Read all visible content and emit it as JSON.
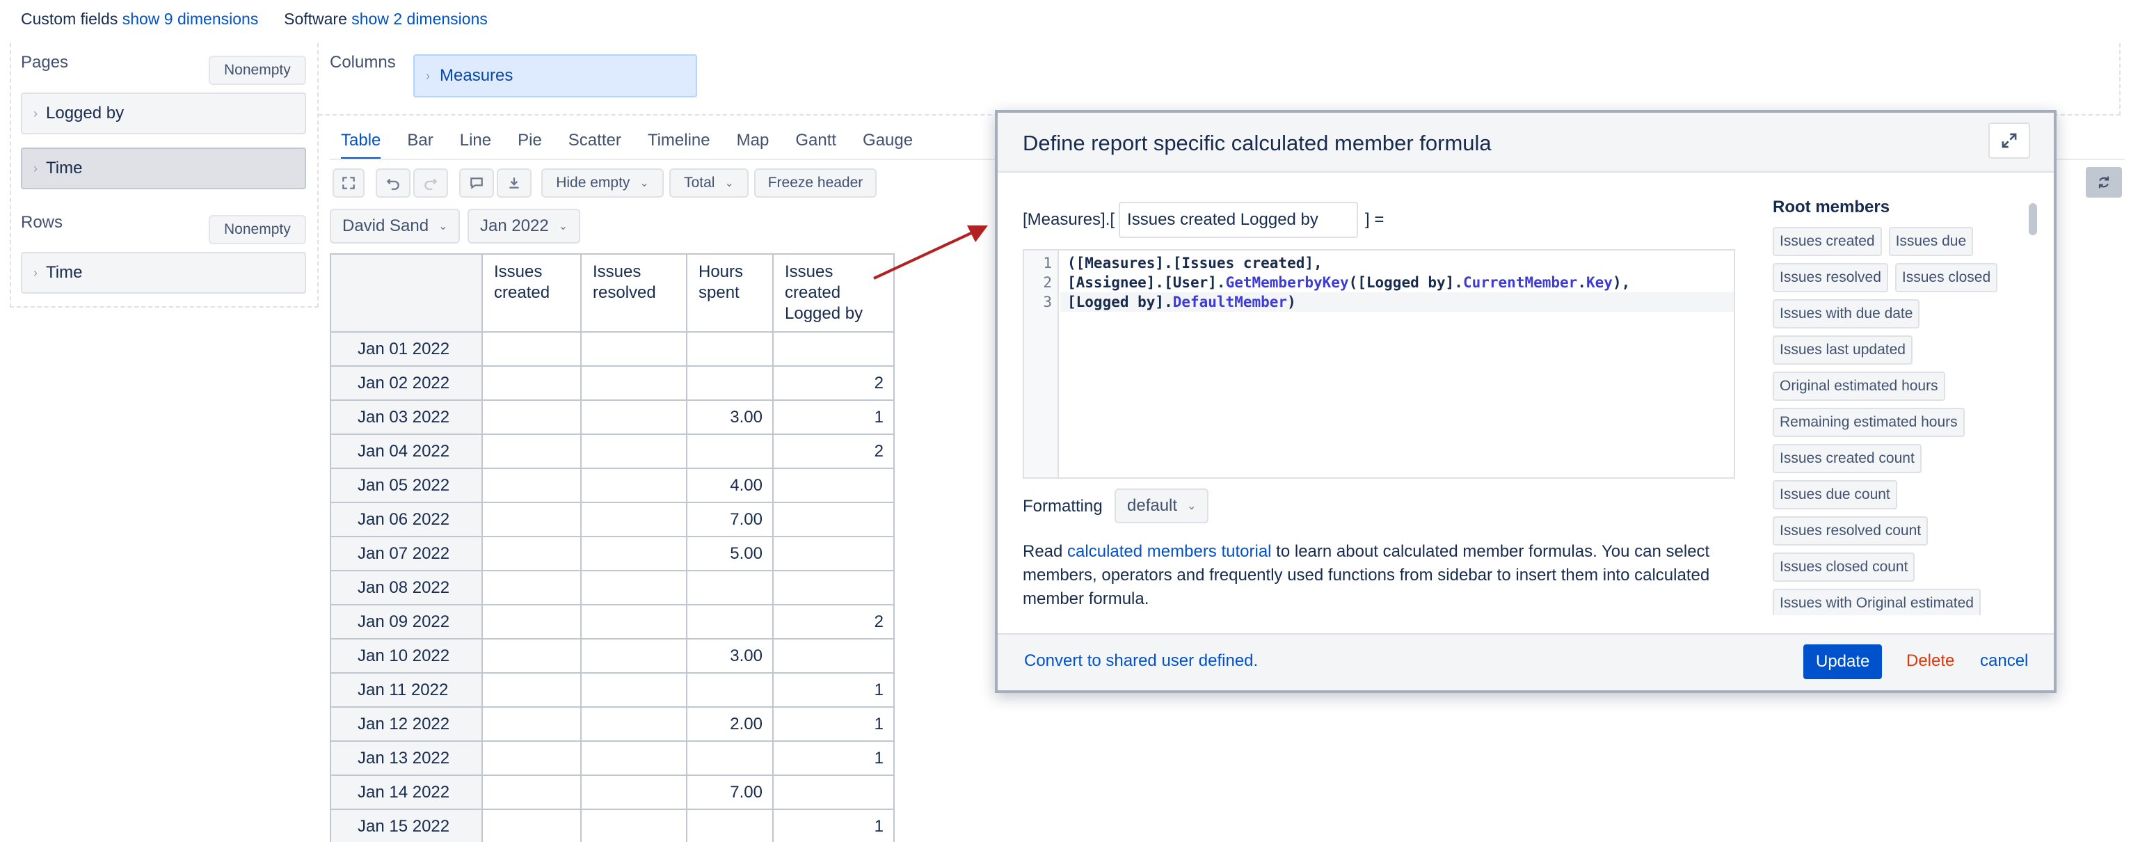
{
  "top_dims": {
    "custom_fields_label": "Custom fields",
    "custom_fields_link": "show 9 dimensions",
    "software_label": "Software",
    "software_link": "show 2 dimensions"
  },
  "pages": {
    "title": "Pages",
    "nonempty": "Nonempty",
    "items": [
      "Logged by",
      "Time"
    ]
  },
  "rows": {
    "title": "Rows",
    "nonempty": "Nonempty",
    "items": [
      "Time"
    ]
  },
  "columns": {
    "title": "Columns",
    "item": "Measures"
  },
  "chart_tabs": [
    "Table",
    "Bar",
    "Line",
    "Pie",
    "Scatter",
    "Timeline",
    "Map",
    "Gantt",
    "Gauge"
  ],
  "toolbar": {
    "hide_empty": "Hide empty",
    "total": "Total",
    "freeze_header": "Freeze header"
  },
  "filters": {
    "user": "David Sand",
    "period": "Jan 2022"
  },
  "table": {
    "headers": [
      [
        "Issues",
        "created"
      ],
      [
        "Issues",
        "resolved"
      ],
      [
        "Hours",
        "spent"
      ],
      [
        "Issues",
        "created",
        "Logged by"
      ]
    ],
    "rows": [
      {
        "label": "Jan 01 2022",
        "cells": [
          "",
          "",
          "",
          ""
        ]
      },
      {
        "label": "Jan 02 2022",
        "cells": [
          "",
          "",
          "",
          "2"
        ]
      },
      {
        "label": "Jan 03 2022",
        "cells": [
          "",
          "",
          "3.00",
          "1"
        ]
      },
      {
        "label": "Jan 04 2022",
        "cells": [
          "",
          "",
          "",
          "2"
        ]
      },
      {
        "label": "Jan 05 2022",
        "cells": [
          "",
          "",
          "4.00",
          ""
        ]
      },
      {
        "label": "Jan 06 2022",
        "cells": [
          "",
          "",
          "7.00",
          ""
        ]
      },
      {
        "label": "Jan 07 2022",
        "cells": [
          "",
          "",
          "5.00",
          ""
        ]
      },
      {
        "label": "Jan 08 2022",
        "cells": [
          "",
          "",
          "",
          ""
        ]
      },
      {
        "label": "Jan 09 2022",
        "cells": [
          "",
          "",
          "",
          "2"
        ]
      },
      {
        "label": "Jan 10 2022",
        "cells": [
          "",
          "",
          "3.00",
          ""
        ]
      },
      {
        "label": "Jan 11 2022",
        "cells": [
          "",
          "",
          "",
          "1"
        ]
      },
      {
        "label": "Jan 12 2022",
        "cells": [
          "",
          "",
          "2.00",
          "1"
        ]
      },
      {
        "label": "Jan 13 2022",
        "cells": [
          "",
          "",
          "",
          "1"
        ]
      },
      {
        "label": "Jan 14 2022",
        "cells": [
          "",
          "",
          "7.00",
          ""
        ]
      },
      {
        "label": "Jan 15 2022",
        "cells": [
          "",
          "",
          "",
          "1"
        ]
      }
    ]
  },
  "modal": {
    "title": "Define report specific calculated member formula",
    "prefix": "[Measures].[",
    "name_value": "Issues created Logged by",
    "suffix": "] =",
    "line_numbers": [
      "1",
      "2",
      "3"
    ],
    "formatting_label": "Formatting",
    "formatting_value": "default",
    "help_read": "Read ",
    "help_link": "calculated members tutorial",
    "help_rest": " to learn about calculated member formulas. You can select members, operators and frequently used functions from sidebar to insert them into calculated member formula.",
    "sidebar_title": "Root members",
    "root_members": [
      "Issues created",
      "Issues due",
      "Issues resolved",
      "Issues closed",
      "Issues with due date",
      "Issues last updated",
      "Original estimated hours",
      "Remaining estimated hours",
      "Issues created count",
      "Issues due count",
      "Issues resolved count",
      "Issues closed count",
      "Issues with Original estimated"
    ],
    "convert_link": "Convert to shared user defined.",
    "update": "Update",
    "delete": "Delete",
    "cancel": "cancel"
  },
  "colors": {
    "accent": "#0052cc",
    "danger": "#de350b",
    "arrow": "#b22222"
  }
}
